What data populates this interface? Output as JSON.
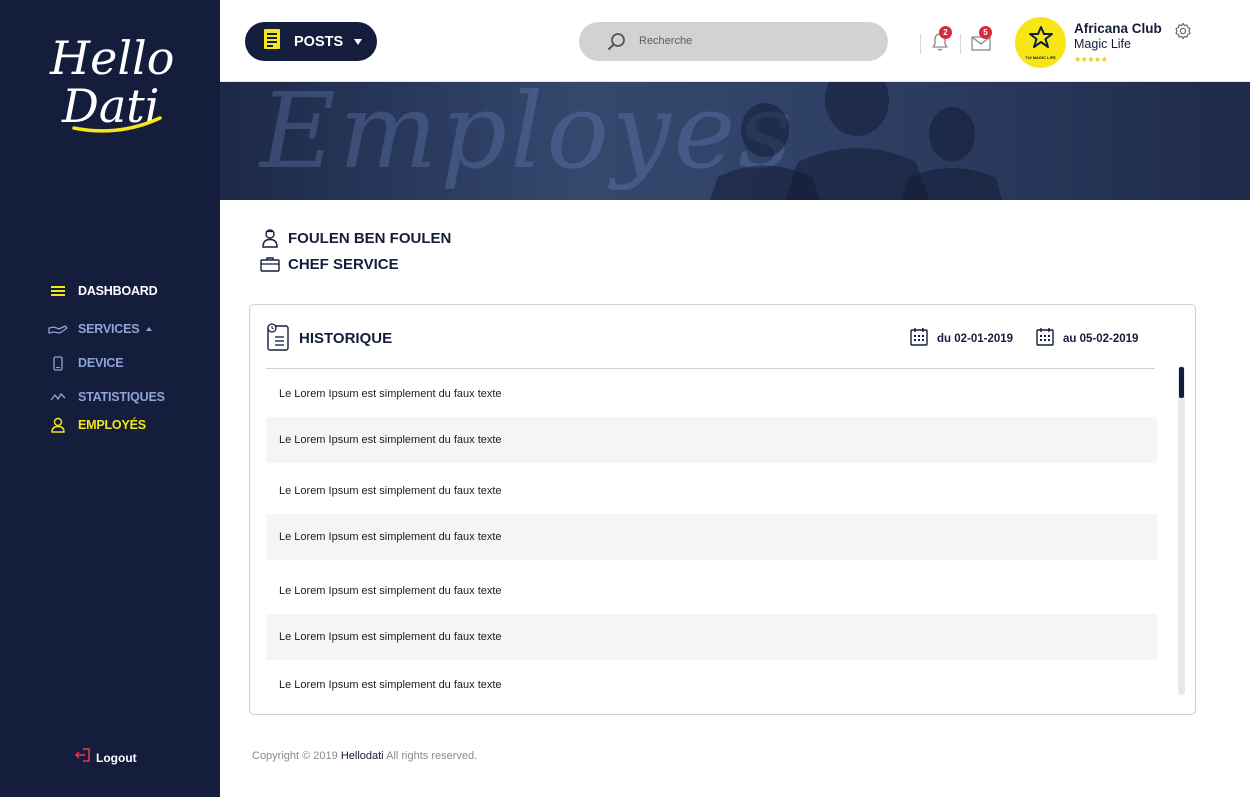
{
  "brand": {
    "logo_line1": "Hello",
    "logo_line2": "Dati"
  },
  "sidebar": {
    "items": [
      {
        "label": "DASHBOARD",
        "icon": "dashboard-icon"
      },
      {
        "label": "SERVICES",
        "icon": "services-hand-icon"
      },
      {
        "label": "DEVICE",
        "icon": "device-phone-icon"
      },
      {
        "label": "STATISTIQUES",
        "icon": "statistics-chart-icon"
      },
      {
        "label": "EMPLOYÉS",
        "icon": "employees-icon"
      }
    ],
    "logout": "Logout"
  },
  "header": {
    "posts_label": "POSTS",
    "search_placeholder": "Recherche",
    "notifications_count": "2",
    "messages_count": "5",
    "club_name": "Africana Club",
    "club_subtitle": "Magic Life",
    "avatar_caption": "TUI MAGIC LIFE",
    "rating": "★★★★★"
  },
  "banner": {
    "title": "Employes"
  },
  "profile": {
    "name": "FOULEN BEN FOULEN",
    "role": "CHEF SERVICE"
  },
  "history": {
    "title": "HISTORIQUE",
    "date_from": "du 02-01-2019",
    "date_to": "au 05-02-2019",
    "rows": [
      "Le Lorem Ipsum est simplement du faux texte",
      "Le Lorem Ipsum est simplement du faux texte",
      "Le Lorem Ipsum est simplement du faux texte",
      "Le Lorem Ipsum est simplement du faux texte",
      "Le Lorem Ipsum est simplement du faux texte",
      "Le Lorem Ipsum est simplement du faux texte",
      "Le Lorem Ipsum est simplement du faux texte"
    ]
  },
  "footer": {
    "prefix": "Copyright © 2019",
    "brand": "Hellodati",
    "suffix": "All rights reserved."
  },
  "colors": {
    "navy": "#141d3b",
    "accent_yellow": "#f5e51b",
    "nav_blue": "#8fa4d6",
    "badge_red": "#d62b3d"
  }
}
